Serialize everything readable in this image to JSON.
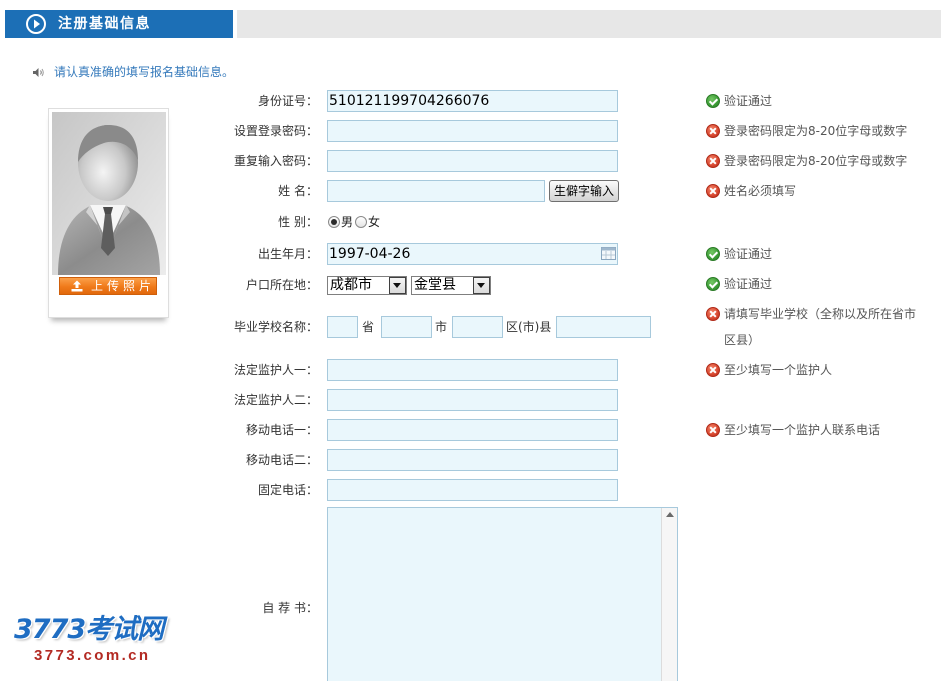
{
  "theme": {
    "header_blue": "#1c6fb6",
    "header_gray": "#e7e7e7",
    "notice_blue": "#3479bb",
    "input_bg": "#eaf7fc",
    "input_border": "#a7c9dc",
    "ok_green": "#3b9b36",
    "error_red": "#d6462f",
    "upload_orange": "#f07a1a"
  },
  "header": {
    "title": "注册基础信息",
    "icon": "play-circle-icon"
  },
  "notice": {
    "icon": "speaker-icon",
    "text": "请认真准确的填写报名基础信息。"
  },
  "photo": {
    "icon": "avatar-placeholder",
    "upload_icon": "upload-icon",
    "upload_label": "上传照片"
  },
  "form": {
    "id_number": {
      "label": "身份证号：",
      "value": "510121199704266076",
      "msg": {
        "icon": "check-circle-icon",
        "text": "验证通过"
      }
    },
    "password": {
      "label": "设置登录密码：",
      "msg": {
        "icon": "error-circle-icon",
        "text": "登录密码限定为8-20位字母或数字"
      }
    },
    "password_confirm": {
      "label": "重复输入密码：",
      "msg": {
        "icon": "error-circle-icon",
        "text": "登录密码限定为8-20位字母或数字"
      }
    },
    "name": {
      "label": "姓 名：",
      "rare_char_button": "生僻字输入",
      "msg": {
        "icon": "error-circle-icon",
        "text": "姓名必须填写"
      }
    },
    "gender": {
      "label": "性 别：",
      "options": [
        {
          "label": "男",
          "checked": true
        },
        {
          "label": "女",
          "checked": false
        }
      ]
    },
    "birthdate": {
      "label": "出生年月：",
      "value": "1997-04-26",
      "icon": "calendar-icon",
      "msg": {
        "icon": "check-circle-icon",
        "text": "验证通过"
      }
    },
    "hukou": {
      "label": "户口所在地：",
      "city": "成都市",
      "county": "金堂县",
      "msg": {
        "icon": "check-circle-icon",
        "text": "验证通过"
      }
    },
    "school": {
      "label": "毕业学校名称：",
      "province_suffix": "省",
      "city_suffix": "市",
      "county_suffix": "区(市)县",
      "msg": {
        "icon": "error-circle-icon",
        "text": "请填写毕业学校（全称以及所在省市区县）"
      }
    },
    "guardian1": {
      "label": "法定监护人一：",
      "msg": {
        "icon": "error-circle-icon",
        "text": "至少填写一个监护人"
      }
    },
    "guardian2": {
      "label": "法定监护人二："
    },
    "mobile1": {
      "label": "移动电话一：",
      "msg": {
        "icon": "error-circle-icon",
        "text": "至少填写一个监护人联系电话"
      }
    },
    "mobile2": {
      "label": "移动电话二："
    },
    "landline": {
      "label": "固定电话："
    },
    "statement": {
      "label": "自 荐 书："
    }
  },
  "watermark": {
    "logo": "3773考试网",
    "site": "3773.com.cn"
  }
}
